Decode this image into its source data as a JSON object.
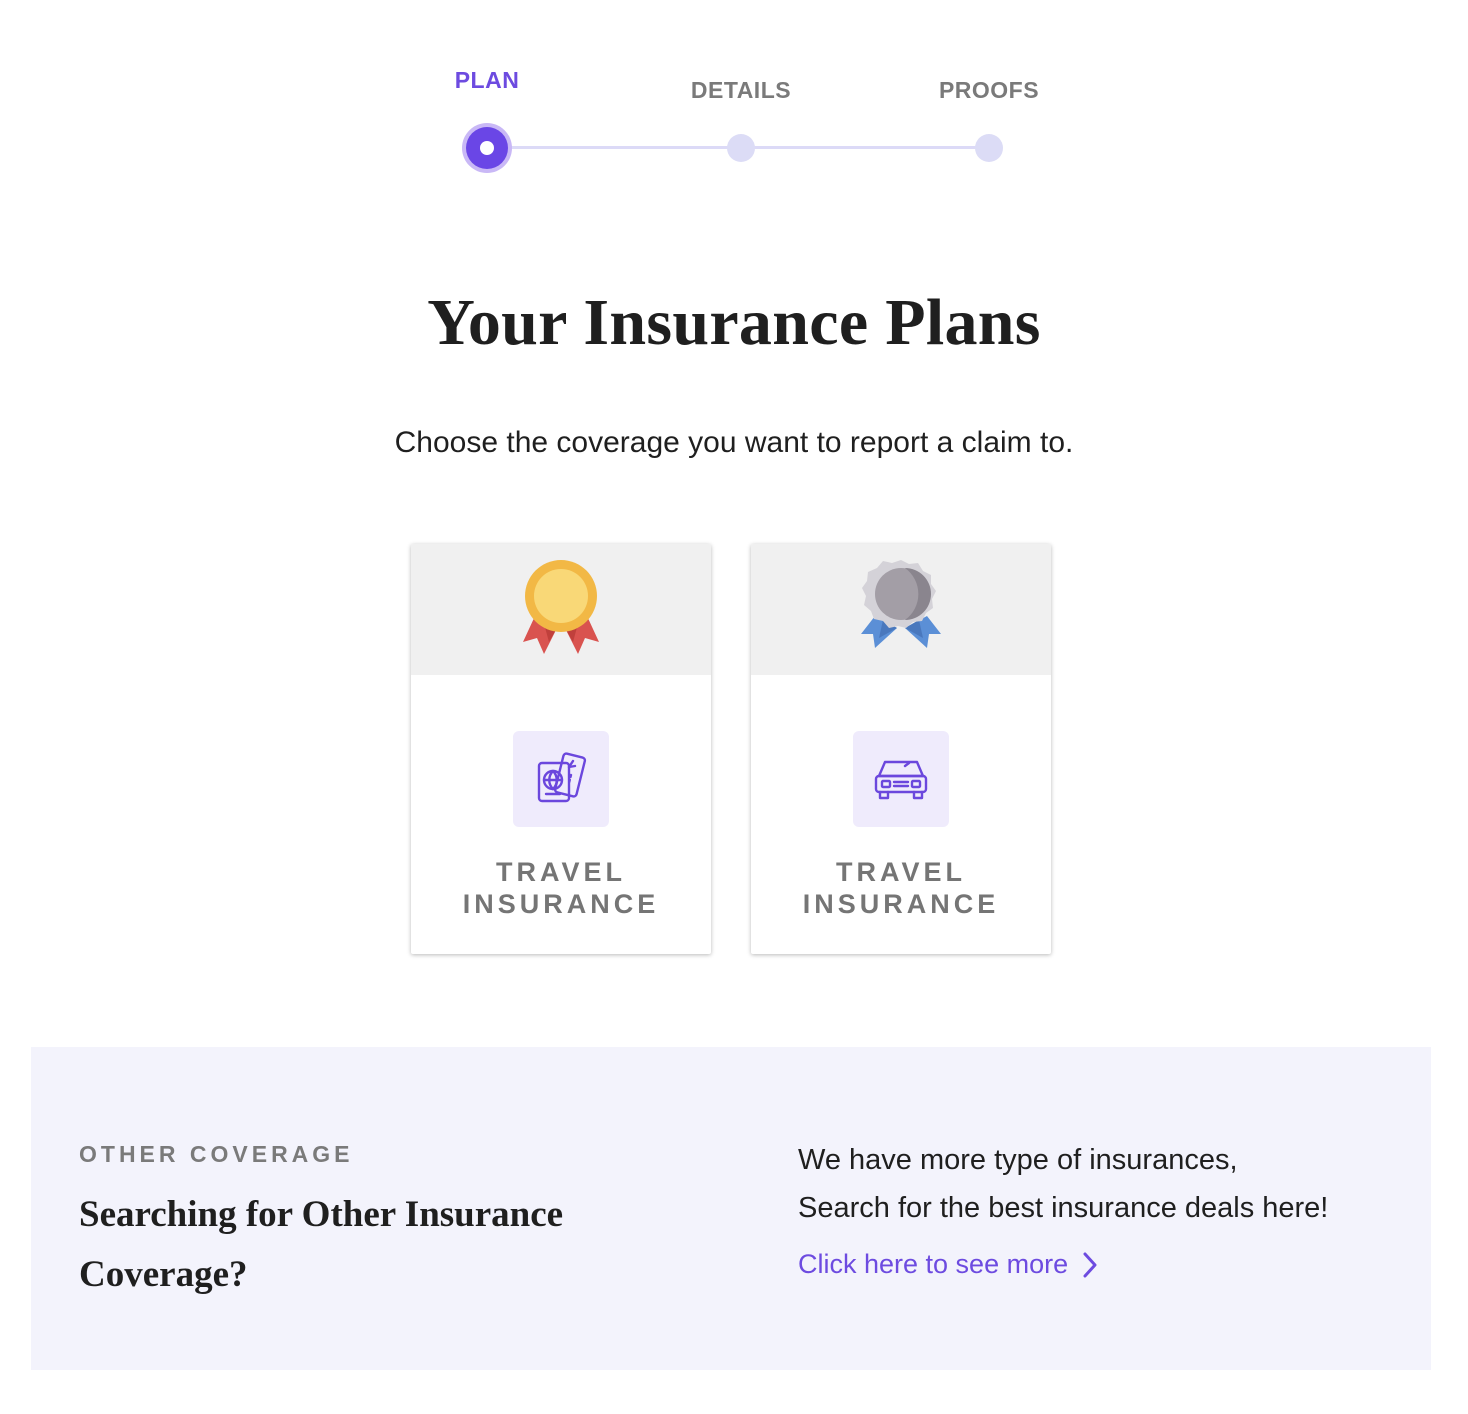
{
  "stepper": {
    "steps": [
      {
        "label": "PLAN",
        "state": "active"
      },
      {
        "label": "DETAILS",
        "state": "upcoming"
      },
      {
        "label": "PROOFS",
        "state": "upcoming"
      }
    ],
    "accent_color": "#6a46e6",
    "inactive_color": "#dcdcf6"
  },
  "header": {
    "title": "Your Insurance Plans",
    "subtitle": "Choose the coverage you want to report a claim to."
  },
  "plans": [
    {
      "tier_icon": "gold-medal-icon",
      "type_icon": "passport-ticket-icon",
      "label": "TRAVEL\nINSURANCE"
    },
    {
      "tier_icon": "silver-medal-icon",
      "type_icon": "car-icon",
      "label": "TRAVEL\nINSURANCE"
    }
  ],
  "other_coverage": {
    "eyebrow": "OTHER COVERAGE",
    "heading": "Searching for Other Insurance Coverage?",
    "text_line1": "We have more type of insurances,",
    "text_line2": "Search for the best insurance deals here!",
    "link_label": "Click here to see more",
    "link_icon": "chevron-right-icon",
    "background": "#f3f3fc",
    "link_color": "#6d4be0"
  }
}
